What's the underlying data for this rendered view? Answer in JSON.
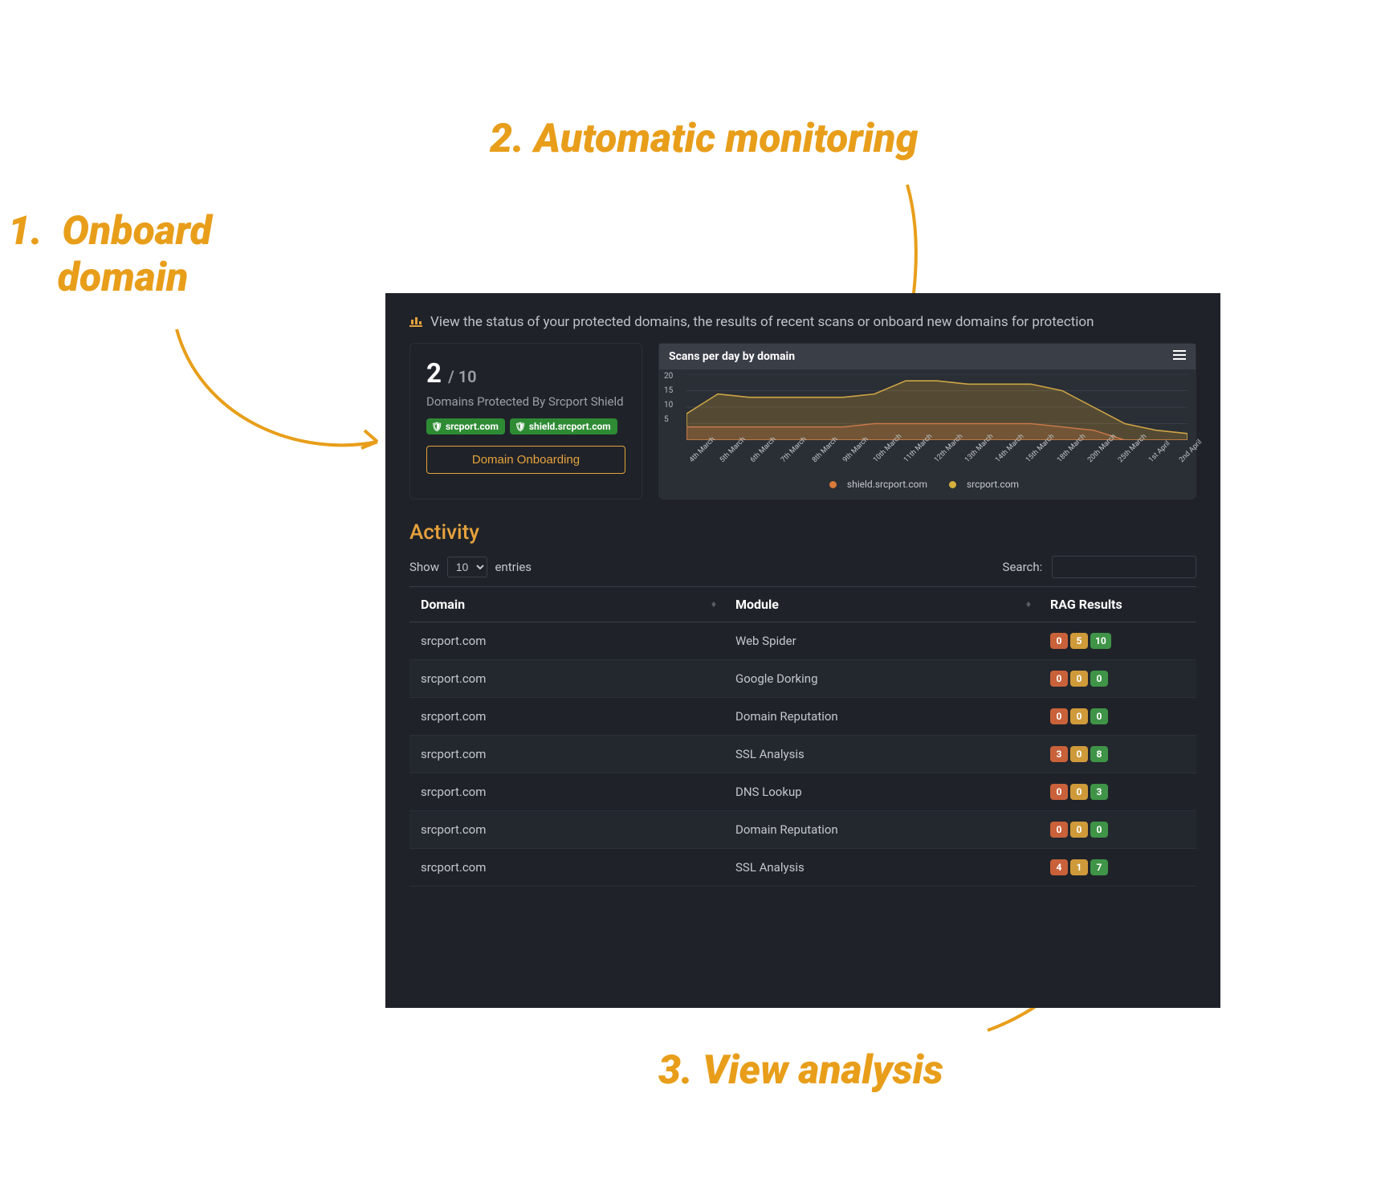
{
  "callouts": {
    "c1": "1.  Onboard\n     domain",
    "c2": "2. Automatic monitoring",
    "c3": "3. View analysis"
  },
  "intro": "View the status of your protected domains, the results of recent scans or onboard new domains for protection",
  "domains_card": {
    "count": "2",
    "total": "/ 10",
    "subtitle": "Domains Protected By Srcport Shield",
    "badges": [
      "srcport.com",
      "shield.srcport.com"
    ],
    "button": "Domain Onboarding"
  },
  "chart": {
    "title": "Scans per day by domain",
    "legend": [
      {
        "name": "shield.srcport.com",
        "color": "orange"
      },
      {
        "name": "srcport.com",
        "color": "yellow"
      }
    ]
  },
  "chart_data": {
    "type": "area",
    "title": "Scans per day by domain",
    "xlabel": "",
    "ylabel": "",
    "ylim": [
      0,
      20
    ],
    "yticks": [
      5,
      10,
      15,
      20
    ],
    "categories": [
      "4th March",
      "5th March",
      "6th March",
      "7th March",
      "8th March",
      "9th March",
      "10th March",
      "11th March",
      "12th March",
      "13th March",
      "14th March",
      "15th March",
      "18th March",
      "20th March",
      "25th March",
      "1st April",
      "2nd April"
    ],
    "series": [
      {
        "name": "shield.srcport.com",
        "values": [
          4,
          4,
          4,
          4,
          4,
          4,
          5,
          5,
          5,
          5,
          5,
          5,
          4,
          3,
          0,
          0,
          0
        ]
      },
      {
        "name": "srcport.com",
        "values": [
          8,
          14,
          13,
          13,
          13,
          13,
          14,
          18,
          18,
          17,
          17,
          17,
          15,
          10,
          5,
          3,
          2
        ]
      }
    ]
  },
  "activity_title": "Activity",
  "table_controls": {
    "show_prefix": "Show",
    "entries_value": "10",
    "show_suffix": "entries",
    "search_label": "Search:"
  },
  "columns": {
    "domain": "Domain",
    "module": "Module",
    "rag": "RAG Results"
  },
  "rows": [
    {
      "domain": "srcport.com",
      "module": "Web Spider",
      "r": "0",
      "a": "5",
      "g": "10"
    },
    {
      "domain": "srcport.com",
      "module": "Google Dorking",
      "r": "0",
      "a": "0",
      "g": "0"
    },
    {
      "domain": "srcport.com",
      "module": "Domain Reputation",
      "r": "0",
      "a": "0",
      "g": "0"
    },
    {
      "domain": "srcport.com",
      "module": "SSL Analysis",
      "r": "3",
      "a": "0",
      "g": "8"
    },
    {
      "domain": "srcport.com",
      "module": "DNS Lookup",
      "r": "0",
      "a": "0",
      "g": "3"
    },
    {
      "domain": "srcport.com",
      "module": "Domain Reputation",
      "r": "0",
      "a": "0",
      "g": "0"
    },
    {
      "domain": "srcport.com",
      "module": "SSL Analysis",
      "r": "4",
      "a": "1",
      "g": "7"
    }
  ]
}
